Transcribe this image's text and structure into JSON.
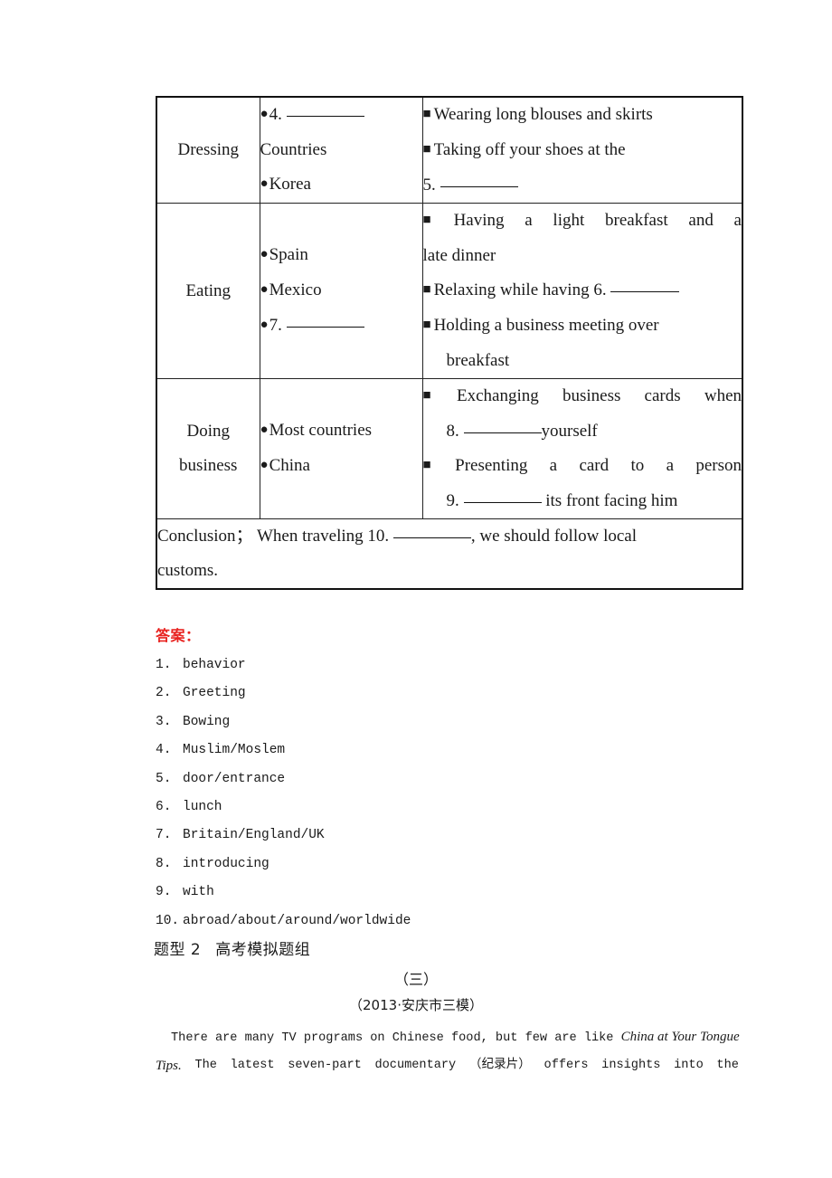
{
  "table": {
    "rows": [
      {
        "category": [
          "Dressing"
        ],
        "places": [
          {
            "bullet": "circle",
            "text": "4.",
            "blank": "long",
            "after": ""
          },
          {
            "bullet": "none",
            "text": "Countries",
            "blank": "",
            "after": ""
          },
          {
            "bullet": "circle",
            "text": "Korea",
            "blank": "",
            "after": ""
          }
        ],
        "details": [
          {
            "bullet": "square",
            "text": "Wearing long blouses and skirts"
          },
          {
            "bullet": "square",
            "text": "Taking off your shoes at the"
          },
          {
            "bullet": "none",
            "text": "5.",
            "blank": "long"
          }
        ]
      },
      {
        "category": [
          "Eating"
        ],
        "places": [
          {
            "bullet": "circle",
            "text": "Spain"
          },
          {
            "bullet": "circle",
            "text": "Mexico"
          },
          {
            "bullet": "circle",
            "text": "7.",
            "blank": "long"
          }
        ],
        "details": [
          {
            "bullet": "square-sp",
            "text": "Having a light breakfast and a",
            "justify": true
          },
          {
            "bullet": "none",
            "text": "late dinner"
          },
          {
            "bullet": "square",
            "text": "Relaxing while having 6.",
            "blank": "med"
          },
          {
            "bullet": "square",
            "text": "Holding a business meeting over"
          },
          {
            "bullet": "none",
            "indent": true,
            "text": "breakfast"
          }
        ]
      },
      {
        "category": [
          "Doing",
          "business"
        ],
        "places": [
          {
            "bullet": "circle",
            "text": "Most countries"
          },
          {
            "bullet": "circle",
            "text": "China"
          }
        ],
        "details": [
          {
            "bullet": "square-sp",
            "text": "Exchanging business cards when",
            "justify": true
          },
          {
            "bullet": "none",
            "indent": true,
            "text": "8.",
            "blank": "long",
            "after": "yourself"
          },
          {
            "bullet": "square-sp",
            "text": "Presenting a card to a person",
            "justify": true
          },
          {
            "bullet": "none",
            "indent": true,
            "text": "9.",
            "blank": "long",
            "after": " its front facing him"
          }
        ]
      }
    ],
    "conclusion": {
      "label": "Conclusion",
      "separator": "；",
      "text_before": "When traveling 10.",
      "blank": "long",
      "text_after": ", we should follow local",
      "line2": "customs."
    }
  },
  "answers": {
    "label": "答案：",
    "items": [
      {
        "num": "1.",
        "text": "behavior"
      },
      {
        "num": "2.",
        "text": "Greeting"
      },
      {
        "num": "3.",
        "text": "Bowing"
      },
      {
        "num": "4.",
        "text": "Muslim/Moslem"
      },
      {
        "num": "5.",
        "text": "door/entrance"
      },
      {
        "num": "6.",
        "text": "lunch"
      },
      {
        "num": "7.",
        "text": "Britain/England/UK"
      },
      {
        "num": "8.",
        "text": "introducing"
      },
      {
        "num": "9.",
        "text": "with"
      },
      {
        "num": "10.",
        "text": "abroad/about/around/worldwide"
      }
    ]
  },
  "bottom": {
    "heading_prefix": "题型 2",
    "heading_title": "高考模拟题组",
    "section_number": "（三）",
    "source": "（2013·安庆市三模）",
    "paragraph": {
      "line1_a": "There are many TV programs on Chinese food, but few are like ",
      "line1_italic": "China at Your Tongue",
      "line2_italic": "Tips.",
      "line2_parts": [
        "The",
        "latest",
        "seven-part",
        "documentary",
        "（纪录片）",
        "offers",
        "insights",
        "into",
        "the"
      ]
    }
  }
}
